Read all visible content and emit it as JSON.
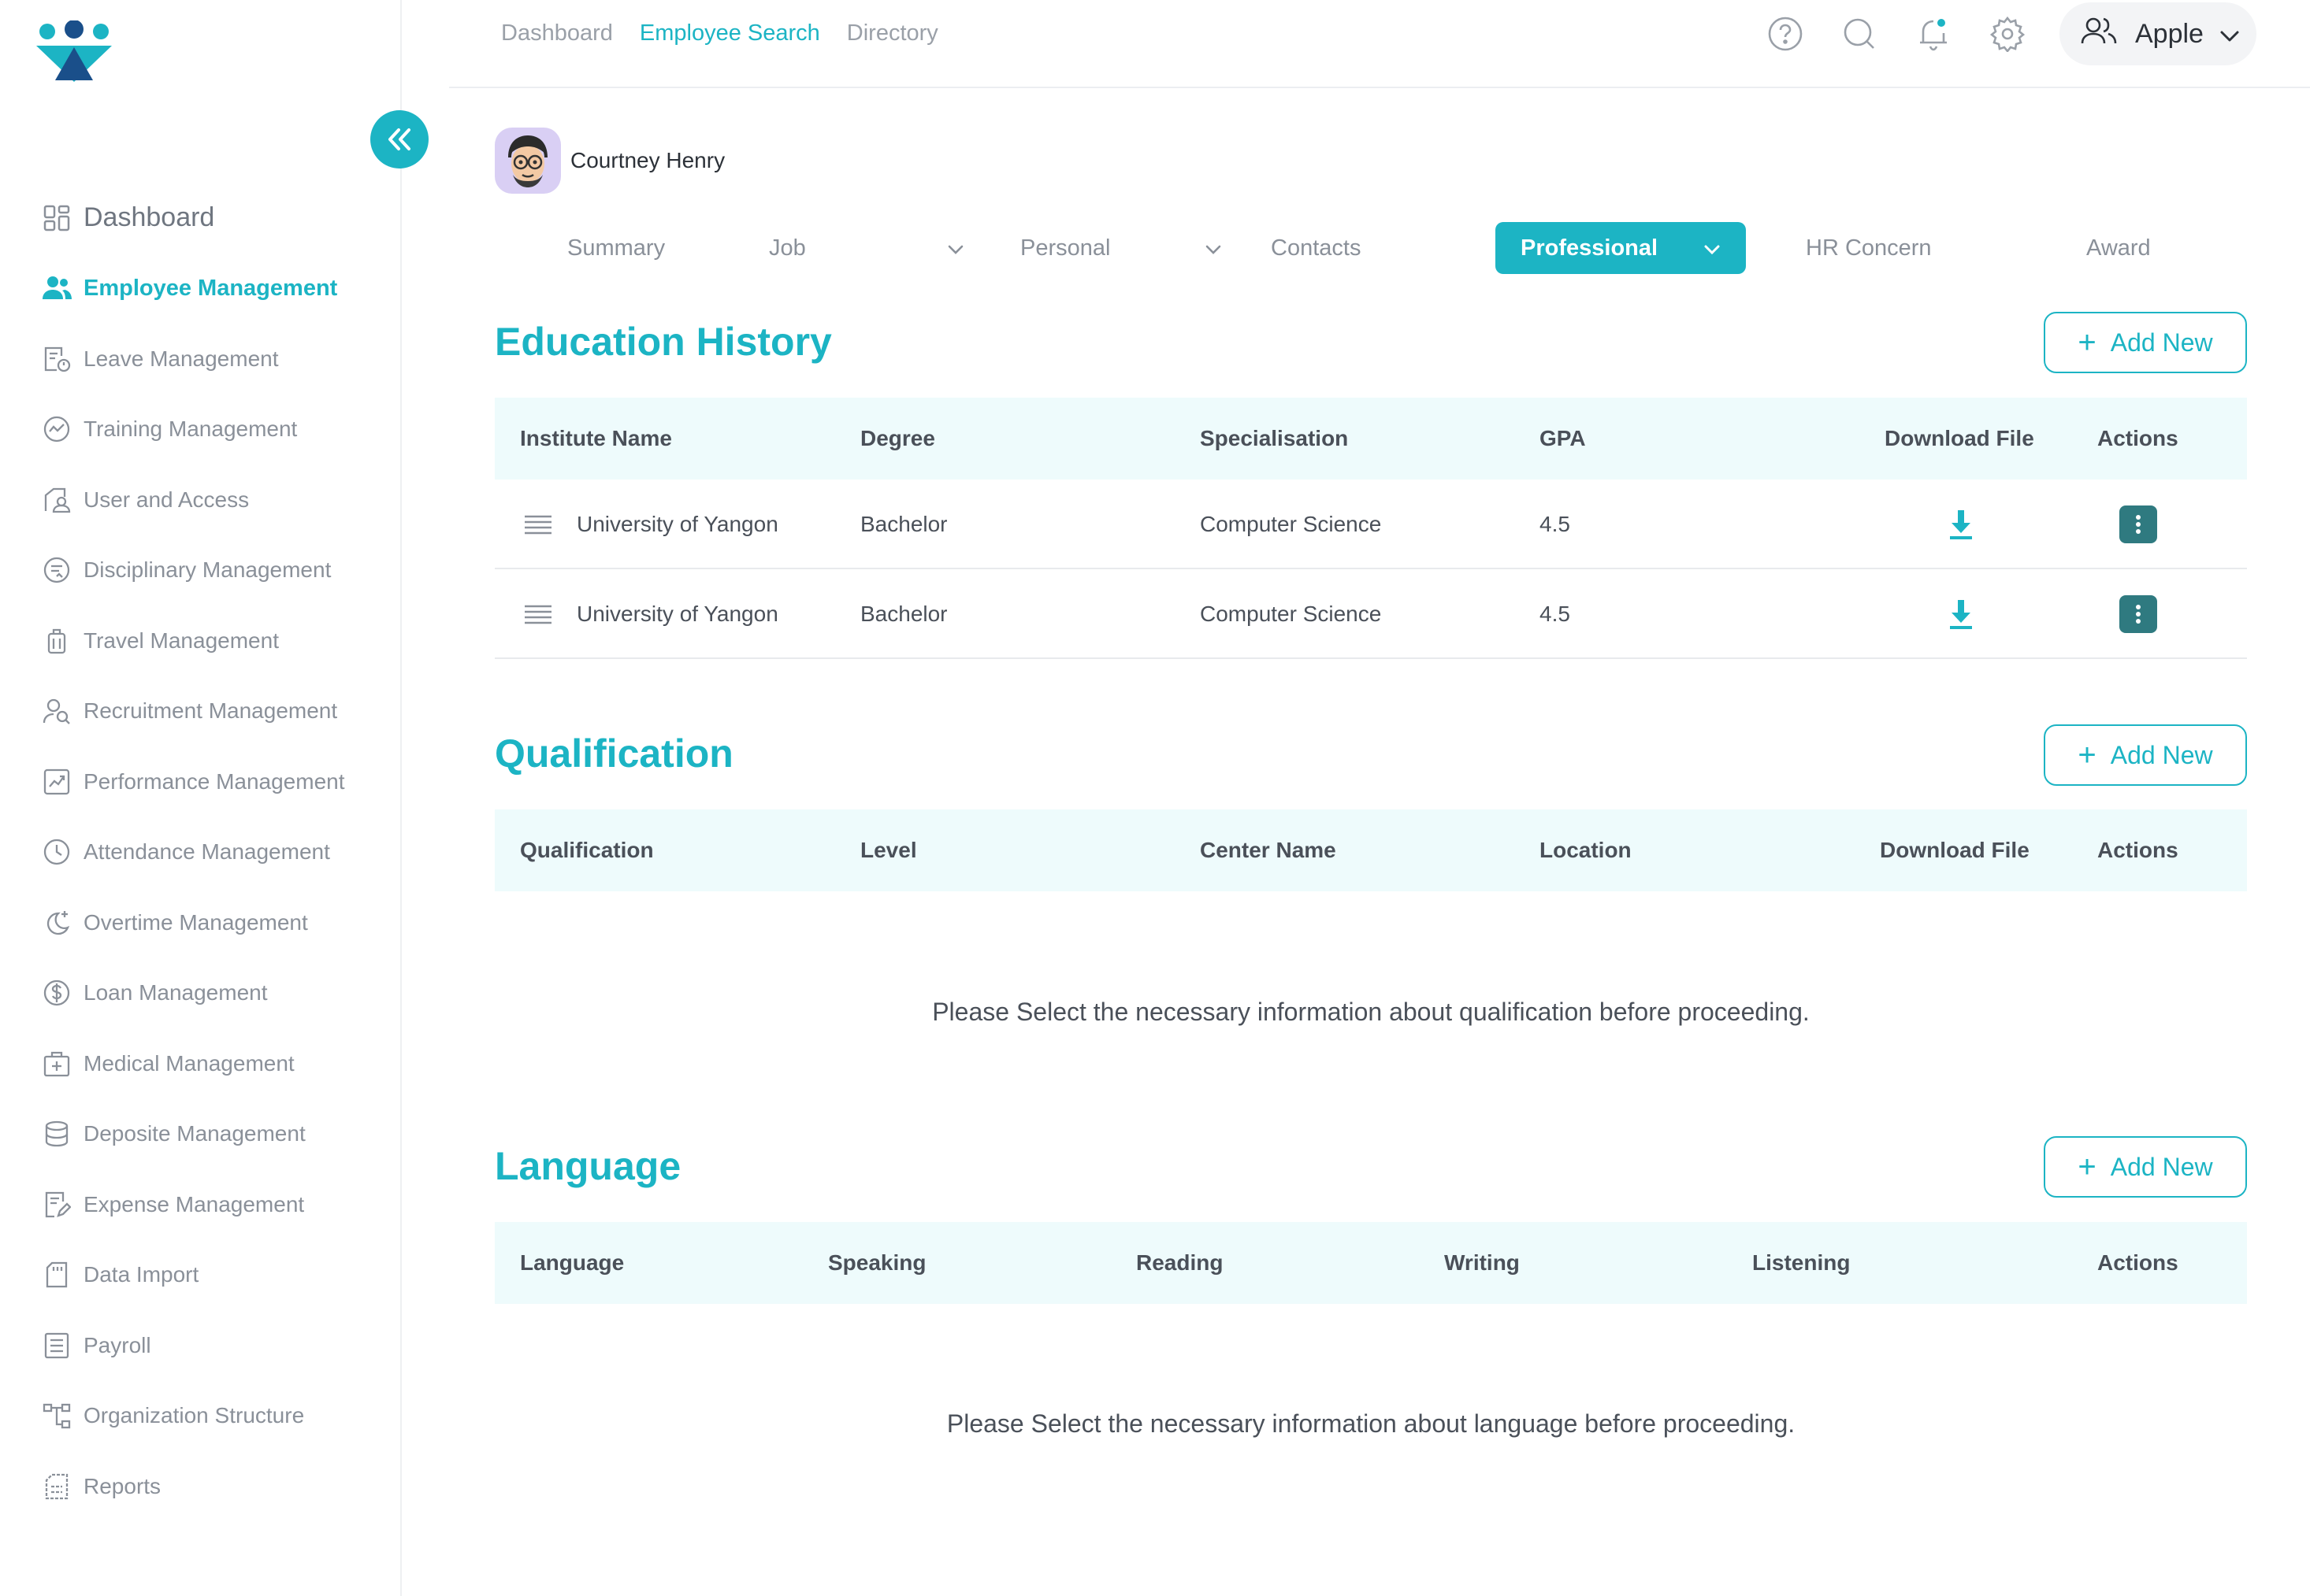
{
  "brand": {
    "accent": "#1cb4c4",
    "dark_teal": "#2f7a80",
    "logo_colors": [
      "#1cb4c4",
      "#1a4f8a"
    ]
  },
  "sidebar": {
    "items": [
      {
        "label": "Dashboard",
        "icon": "dashboard-icon"
      },
      {
        "label": "Employee Management",
        "icon": "users-icon",
        "active": true
      },
      {
        "label": "Leave Management",
        "icon": "leave-icon"
      },
      {
        "label": "Training Management",
        "icon": "training-icon"
      },
      {
        "label": "User and Access",
        "icon": "user-access-icon"
      },
      {
        "label": "Disciplinary Management",
        "icon": "disciplinary-icon"
      },
      {
        "label": "Travel Management",
        "icon": "luggage-icon"
      },
      {
        "label": "Recruitment Management",
        "icon": "recruitment-icon"
      },
      {
        "label": "Performance Management",
        "icon": "chart-icon"
      },
      {
        "label": "Attendance Management",
        "icon": "clock-icon"
      },
      {
        "label": "Overtime Management",
        "icon": "moon-plus-icon"
      },
      {
        "label": "Loan Management",
        "icon": "dollar-icon"
      },
      {
        "label": "Medical Management",
        "icon": "medical-icon"
      },
      {
        "label": "Deposite Management",
        "icon": "database-icon"
      },
      {
        "label": "Expense Management",
        "icon": "expense-icon"
      },
      {
        "label": "Data Import",
        "icon": "sd-card-icon"
      },
      {
        "label": "Payroll",
        "icon": "list-icon"
      },
      {
        "label": "Organization Structure",
        "icon": "org-chart-icon"
      },
      {
        "label": "Reports",
        "icon": "report-icon"
      }
    ]
  },
  "topbar": {
    "nav": [
      "Dashboard",
      "Employee Search",
      "Directory"
    ],
    "active_nav": "Employee Search",
    "user_name": "Apple"
  },
  "profile": {
    "name": "Courtney Henry"
  },
  "tabs": [
    "Summary",
    "Job",
    "Personal",
    "Contacts",
    "Professional",
    "HR Concern",
    "Award"
  ],
  "education": {
    "title": "Education History",
    "add_label": "Add New",
    "columns": [
      "Institute Name",
      "Degree",
      "Specialisation",
      "GPA",
      "Download File",
      "Actions"
    ],
    "rows": [
      {
        "institute": "University of Yangon",
        "degree": "Bachelor",
        "specialisation": "Computer Science",
        "gpa": "4.5"
      },
      {
        "institute": "University of Yangon",
        "degree": "Bachelor",
        "specialisation": "Computer Science",
        "gpa": "4.5"
      }
    ]
  },
  "qualification": {
    "title": "Qualification",
    "add_label": "Add New",
    "columns": [
      "Qualification",
      "Level",
      "Center Name",
      "Location",
      "Download File",
      "Actions"
    ],
    "empty_text": "Please Select the necessary information about qualification before proceeding."
  },
  "language": {
    "title": "Language",
    "add_label": "Add New",
    "columns": [
      "Language",
      "Speaking",
      "Reading",
      "Writing",
      "Listening",
      "Actions"
    ],
    "empty_text": "Please Select the necessary information about language before proceeding."
  }
}
